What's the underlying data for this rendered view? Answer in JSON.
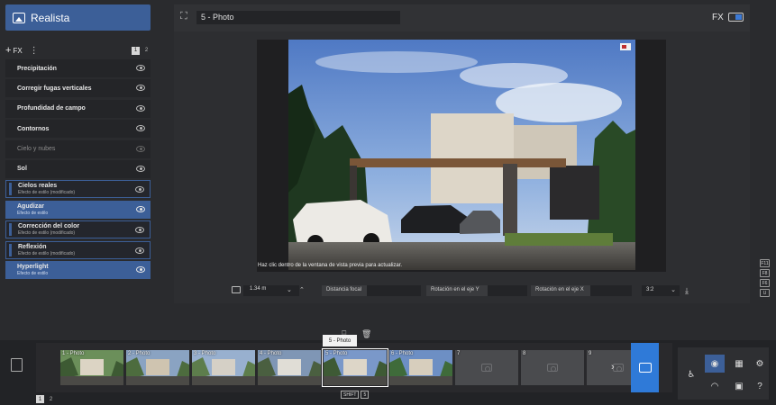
{
  "style_panel": {
    "title": "Realista",
    "add_fx_label": "FX",
    "page_numbers": [
      "1",
      "2"
    ]
  },
  "effects": [
    {
      "name": "Precipitación",
      "subtitle": "",
      "state": "normal"
    },
    {
      "name": "Corregir fugas verticales",
      "subtitle": "",
      "state": "normal"
    },
    {
      "name": "Profundidad de campo",
      "subtitle": "",
      "state": "normal"
    },
    {
      "name": "Contornos",
      "subtitle": "",
      "state": "normal"
    },
    {
      "name": "Cielo y nubes",
      "subtitle": "",
      "state": "disabled"
    },
    {
      "name": "Sol",
      "subtitle": "",
      "state": "normal"
    },
    {
      "name": "Cielos reales",
      "subtitle": "Efecto de estilo (modificado)",
      "state": "modified"
    },
    {
      "name": "Agudizar",
      "subtitle": "Efecto de estilo",
      "state": "selected"
    },
    {
      "name": "Corrección del color",
      "subtitle": "Efecto de estilo (modificado)",
      "state": "modified"
    },
    {
      "name": "Reflexión",
      "subtitle": "Efecto de estilo (modificado)",
      "state": "modified"
    },
    {
      "name": "Hyperlight",
      "subtitle": "Efecto de estilo",
      "state": "selected"
    }
  ],
  "viewport": {
    "photo_name": "5 - Photo",
    "fx_label": "FX",
    "refresh_hint": "Haz clic dentro de la ventana de vista previa para actualizar."
  },
  "camera": {
    "focal_value": "1.34 m",
    "focal_distance_label": "Distancia focal",
    "rotation_y_label": "Rotación en el eje Y",
    "rotation_x_label": "Rotación en el eje X",
    "aspect_ratio": "3:2"
  },
  "function_keys": [
    "F11",
    "F8",
    "F6",
    "U"
  ],
  "gallery": {
    "tooltip": "5 - Photo",
    "shift_key": "SHIFT",
    "shift_num": "5",
    "pages": [
      "1",
      "2"
    ],
    "thumbnails": [
      {
        "label": "1 - Photo",
        "type": "photo"
      },
      {
        "label": "2 - Photo",
        "type": "photo"
      },
      {
        "label": "3 - Photo",
        "type": "photo"
      },
      {
        "label": "4 - Photo",
        "type": "photo"
      },
      {
        "label": "5 - Photo",
        "type": "active"
      },
      {
        "label": "6 - Photo",
        "type": "photo"
      },
      {
        "label": "7",
        "type": "empty"
      },
      {
        "label": "8",
        "type": "empty"
      },
      {
        "label": "9",
        "type": "empty"
      }
    ]
  },
  "colors": {
    "accent": "#3c5f98",
    "save_button": "#2f7ad8",
    "panel": "#242528"
  }
}
